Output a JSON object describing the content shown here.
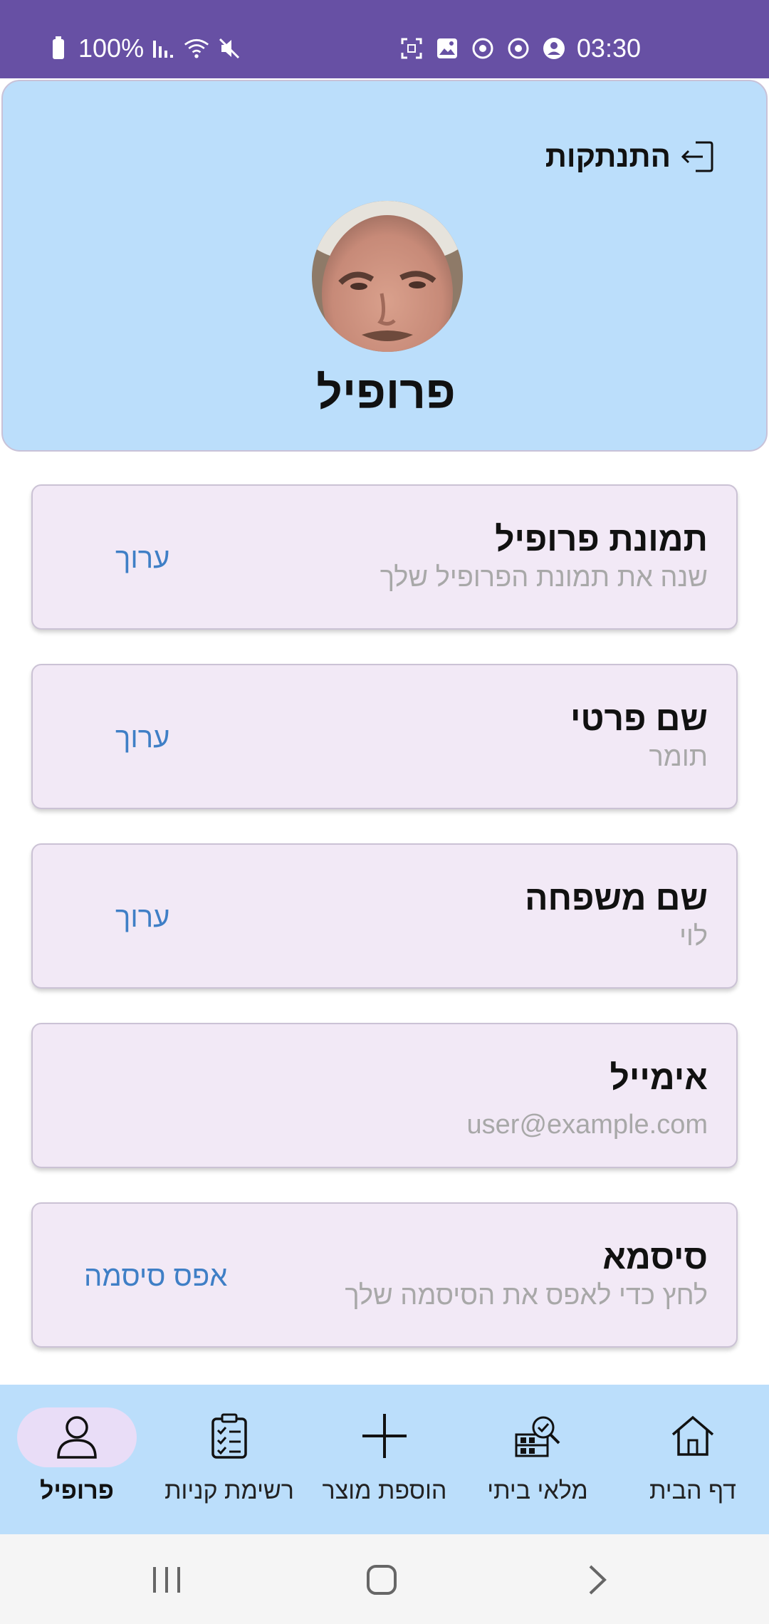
{
  "status_bar": {
    "battery": "100%",
    "time": "03:30",
    "icons_left": [
      "battery-icon",
      "signal-icon",
      "wifi-icon",
      "mute-icon"
    ],
    "icons_right": [
      "screenshot-icon",
      "gallery-icon",
      "sync-icon",
      "sync-icon",
      "account-icon"
    ]
  },
  "header": {
    "logout_label": "התנתקות",
    "title": "פרופיל"
  },
  "cards": [
    {
      "title": "תמונת פרופיל",
      "subtitle": "שנה את תמונת הפרופיל שלך",
      "action": "ערוך"
    },
    {
      "title": "שם פרטי",
      "subtitle": "תומר",
      "action": "ערוך"
    },
    {
      "title": "שם משפחה",
      "subtitle": "לוי",
      "action": "ערוך"
    },
    {
      "title": "אימייל",
      "subtitle": "user@example.com",
      "action": ""
    },
    {
      "title": "סיסמא",
      "subtitle": "לחץ כדי לאפס את הסיסמה שלך",
      "action": "אפס סיסמה"
    }
  ],
  "bottom_nav": {
    "items": [
      {
        "label": "פרופיל",
        "icon": "person-icon",
        "active": true
      },
      {
        "label": "רשימת קניות",
        "icon": "checklist-icon",
        "active": false
      },
      {
        "label": "הוספת מוצר",
        "icon": "plus-icon",
        "active": false
      },
      {
        "label": "מלאי ביתי",
        "icon": "inventory-icon",
        "active": false
      },
      {
        "label": "דף הבית",
        "icon": "home-icon",
        "active": false
      }
    ]
  },
  "colors": {
    "status_bar": "#6750a4",
    "header_bg": "#bbdefb",
    "card_bg": "#f2e9f6",
    "action_link": "#3f7fc6",
    "nav_active_pill": "#e9ddf7"
  }
}
